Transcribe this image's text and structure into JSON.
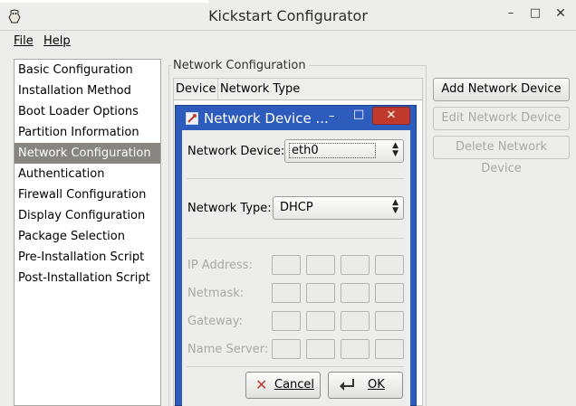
{
  "window": {
    "title": "Kickstart Configurator",
    "icon": "kickstart-app-icon",
    "min_glyph": "–",
    "max_glyph": "□",
    "close_glyph": "✕"
  },
  "menu": {
    "file": "File",
    "help": "Help"
  },
  "sidebar": {
    "items": [
      "Basic Configuration",
      "Installation Method",
      "Boot Loader Options",
      "Partition Information",
      "Network Configuration",
      "Authentication",
      "Firewall Configuration",
      "Display Configuration",
      "Package Selection",
      "Pre-Installation Script",
      "Post-Installation Script"
    ],
    "selected": "Network Configuration"
  },
  "network": {
    "frame_title": "Network Configuration",
    "columns": [
      "Device",
      "Network Type"
    ],
    "buttons": {
      "add": "Add Network Device",
      "edit": "Edit Network Device",
      "delete": "Delete Network Device"
    }
  },
  "dialog": {
    "title": "Network Device ...",
    "min_glyph": "–",
    "max_glyph": "□",
    "close_glyph": "✕",
    "device_label": "Network Device:",
    "device_value": "eth0",
    "type_label": "Network Type:",
    "type_value": "DHCP",
    "ip_label": "IP Address:",
    "netmask_label": "Netmask:",
    "gateway_label": "Gateway:",
    "nameserver_label": "Name Server:",
    "cancel": "Cancel",
    "ok": "OK"
  },
  "colors": {
    "selection": "#888580",
    "dialog_frame": "#2e5cbd",
    "close_red": "#c0392b",
    "disabled_text": "#a8a8a5"
  }
}
